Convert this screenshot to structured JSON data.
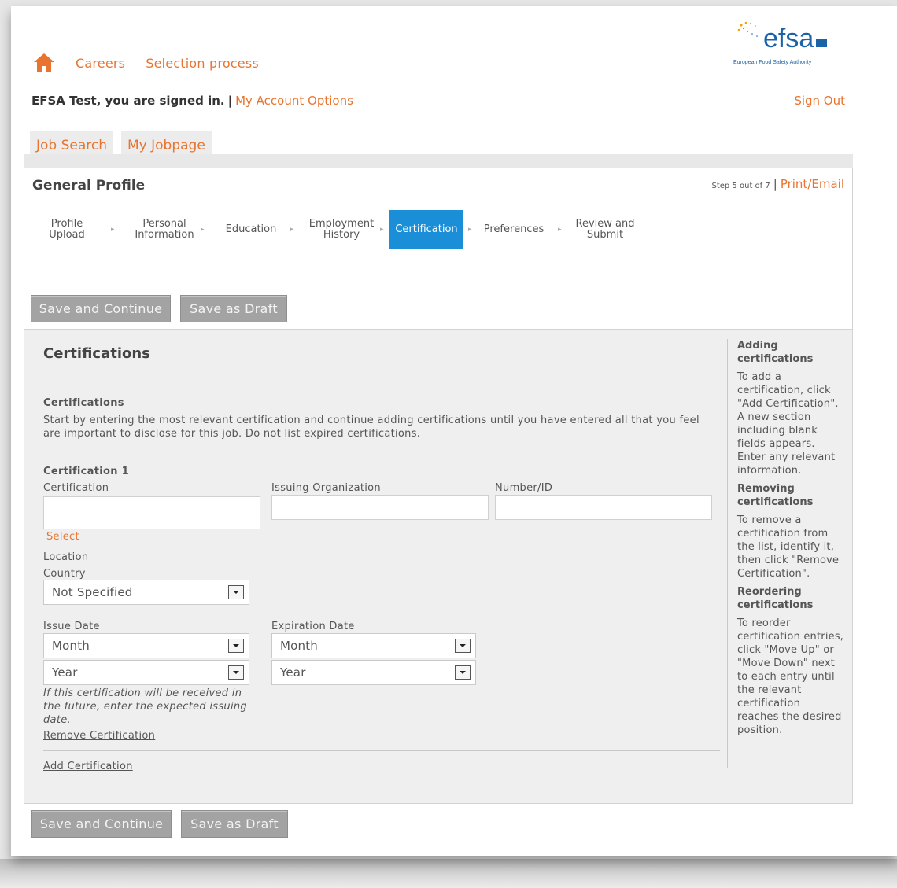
{
  "header": {
    "nav": [
      "Careers",
      "Selection process"
    ],
    "logo": {
      "text": "efsa",
      "subtitle": "European Food Safety Authority"
    },
    "user_text": "EFSA Test, you are signed in.",
    "separator": "|",
    "account_link": "My Account Options",
    "sign_out": "Sign Out"
  },
  "tabs": [
    "Job Search",
    "My Jobpage"
  ],
  "profile": {
    "title": "General Profile",
    "step_text": "Step 5 out of 7",
    "separator": "|",
    "print_link": "Print/Email",
    "steps": [
      {
        "label": "Profile\nUpload",
        "active": false
      },
      {
        "label": "Personal\nInformation",
        "active": false
      },
      {
        "label": "Education",
        "active": false
      },
      {
        "label": "Employment\nHistory",
        "active": false
      },
      {
        "label": "Certification",
        "active": true
      },
      {
        "label": "Preferences",
        "active": false
      },
      {
        "label": "Review and\nSubmit",
        "active": false
      }
    ],
    "save_continue": "Save and Continue",
    "save_draft": "Save as Draft"
  },
  "certifications": {
    "title": "Certifications",
    "section_label": "Certifications",
    "intro": "Start by entering the most relevant certification and continue adding certifications until you have entered all that you feel are important to disclose for this job. Do not list expired certifications.",
    "cert1_label": "Certification 1",
    "certification_label": "Certification",
    "issuing_org_label": "Issuing Organization",
    "number_label": "Number/ID",
    "select_link": "Select",
    "location_label": "Location",
    "country_label": "Country",
    "country_value": "Not Specified",
    "issue_date_label": "Issue Date",
    "expiration_date_label": "Expiration Date",
    "issue_month": "Month",
    "issue_year": "Year",
    "exp_month": "Month",
    "exp_year": "Year",
    "future_note": "If this certification will be received in the future, enter the expected issuing date.",
    "remove_link": "Remove Certification",
    "add_link": "Add Certification"
  },
  "sidebar": {
    "adding_title": "Adding certifications",
    "adding_text": "To add a certification, click \"Add Certification\". A new section including blank fields appears. Enter any relevant information.",
    "removing_title": "Removing certifications",
    "removing_text": "To remove a certification from the list, identify it, then click \"Remove Certification\".",
    "reordering_title": "Reordering certifications",
    "reordering_text": "To reorder certification entries, click \"Move Up\" or \"Move Down\" next to each entry until the relevant certification reaches the desired position."
  },
  "footer": {
    "save_continue": "Save and Continue",
    "save_draft": "Save as Draft"
  },
  "colors": {
    "accent": "#e8742f",
    "active_step": "#1a8fd8",
    "logo_blue": "#1b63a9"
  }
}
